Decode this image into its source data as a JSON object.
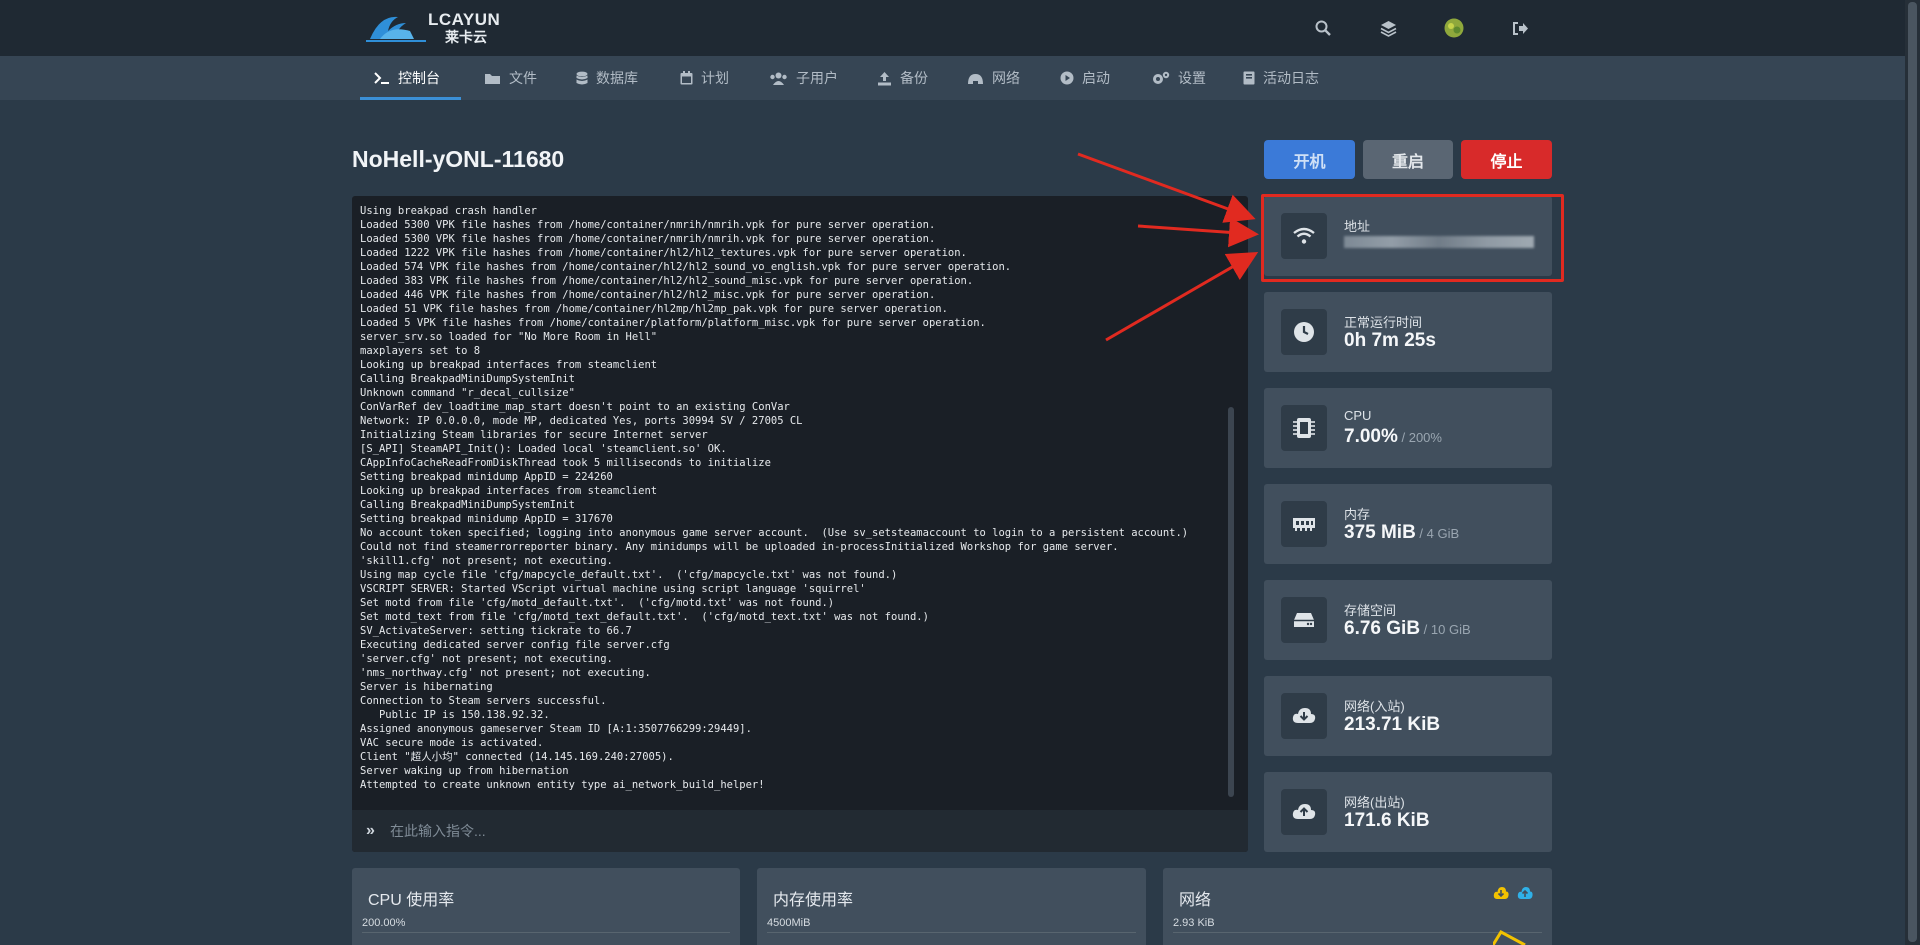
{
  "brand": {
    "logo_text": "LCAYUN",
    "logo_sub": "莱卡云"
  },
  "topbar": {
    "icons": [
      "search-icon",
      "layers-icon",
      "avatar",
      "logout-icon"
    ]
  },
  "nav": [
    {
      "label": "控制台",
      "icon": "terminal-icon",
      "active": true
    },
    {
      "label": "文件",
      "icon": "folder-icon"
    },
    {
      "label": "数据库",
      "icon": "database-icon"
    },
    {
      "label": "计划",
      "icon": "calendar-icon"
    },
    {
      "label": "子用户",
      "icon": "users-icon"
    },
    {
      "label": "备份",
      "icon": "upload-icon"
    },
    {
      "label": "网络",
      "icon": "network-icon"
    },
    {
      "label": "启动",
      "icon": "play-icon"
    },
    {
      "label": "设置",
      "icon": "gears-icon"
    },
    {
      "label": "活动日志",
      "icon": "book-icon"
    }
  ],
  "server": {
    "title": "NoHell-yONL-11680"
  },
  "power": {
    "start": "开机",
    "restart": "重启",
    "stop": "停止"
  },
  "console": {
    "lines": [
      "Using breakpad crash handler",
      "Loaded 5300 VPK file hashes from /home/container/nmrih/nmrih.vpk for pure server operation.",
      "Loaded 5300 VPK file hashes from /home/container/nmrih/nmrih.vpk for pure server operation.",
      "Loaded 1222 VPK file hashes from /home/container/hl2/hl2_textures.vpk for pure server operation.",
      "Loaded 574 VPK file hashes from /home/container/hl2/hl2_sound_vo_english.vpk for pure server operation.",
      "Loaded 383 VPK file hashes from /home/container/hl2/hl2_sound_misc.vpk for pure server operation.",
      "Loaded 446 VPK file hashes from /home/container/hl2/hl2_misc.vpk for pure server operation.",
      "Loaded 51 VPK file hashes from /home/container/hl2mp/hl2mp_pak.vpk for pure server operation.",
      "Loaded 5 VPK file hashes from /home/container/platform/platform_misc.vpk for pure server operation.",
      "server_srv.so loaded for \"No More Room in Hell\"",
      "maxplayers set to 8",
      "Looking up breakpad interfaces from steamclient",
      "Calling BreakpadMiniDumpSystemInit",
      "Unknown command \"r_decal_cullsize\"",
      "ConVarRef dev_loadtime_map_start doesn't point to an existing ConVar",
      "Network: IP 0.0.0.0, mode MP, dedicated Yes, ports 30994 SV / 27005 CL",
      "Initializing Steam libraries for secure Internet server",
      "[S_API] SteamAPI_Init(): Loaded local 'steamclient.so' OK.",
      "CAppInfoCacheReadFromDiskThread took 5 milliseconds to initialize",
      "Setting breakpad minidump AppID = 224260",
      "Looking up breakpad interfaces from steamclient",
      "Calling BreakpadMiniDumpSystemInit",
      "Setting breakpad minidump AppID = 317670",
      "No account token specified; logging into anonymous game server account.  (Use sv_setsteamaccount to login to a persistent account.)",
      "Could not find steamerrorreporter binary. Any minidumps will be uploaded in-processInitialized Workshop for game server.",
      "'skill1.cfg' not present; not executing.",
      "Using map cycle file 'cfg/mapcycle_default.txt'.  ('cfg/mapcycle.txt' was not found.)",
      "VSCRIPT SERVER: Started VScript virtual machine using script language 'squirrel'",
      "Set motd from file 'cfg/motd_default.txt'.  ('cfg/motd.txt' was not found.)",
      "Set motd_text from file 'cfg/motd_text_default.txt'.  ('cfg/motd_text.txt' was not found.)",
      "SV_ActivateServer: setting tickrate to 66.7",
      "Executing dedicated server config file server.cfg",
      "'server.cfg' not present; not executing.",
      "'nms_northway.cfg' not present; not executing.",
      "Server is hibernating",
      "Connection to Steam servers successful.",
      "   Public IP is 150.138.92.32.",
      "Assigned anonymous gameserver Steam ID [A:1:3507766299:29449].",
      "VAC secure mode is activated.",
      "Client \"超人小均\" connected (14.145.169.240:27005).",
      "Server waking up from hibernation",
      "Attempted to create unknown entity type ai_network_build_helper!"
    ],
    "prompt": "»",
    "placeholder": "在此输入指令..."
  },
  "stats": [
    {
      "label": "地址",
      "value": "",
      "icon": "wifi-icon"
    },
    {
      "label": "正常运行时间",
      "value": "0h 7m 25s",
      "sub": "",
      "icon": "clock-icon"
    },
    {
      "label": "CPU",
      "value": "7.00%",
      "sub": " / 200%",
      "icon": "chip-icon"
    },
    {
      "label": "内存",
      "value": "375 MiB",
      "sub": " / 4 GiB",
      "icon": "memory-icon"
    },
    {
      "label": "存储空间",
      "value": "6.76 GiB",
      "sub": " / 10 GiB",
      "icon": "hdd-icon"
    },
    {
      "label": "网络(入站)",
      "value": "213.71 KiB",
      "sub": "",
      "icon": "cloud-download-icon"
    },
    {
      "label": "网络(出站)",
      "value": "171.6 KiB",
      "sub": "",
      "icon": "cloud-upload-icon"
    }
  ],
  "graphs": [
    {
      "title": "CPU 使用率",
      "ymax": "200.00%"
    },
    {
      "title": "内存使用率",
      "ymax": "4500MiB"
    },
    {
      "title": "网络",
      "ymax": "2.93 KiB"
    }
  ],
  "colors": {
    "accent": "#3b8fd6",
    "start": "#3b7ad8",
    "restart": "#5a6673",
    "stop": "#d82a2a",
    "highlight": "#e12a20",
    "net_in": "#f2c200",
    "net_out": "#2fb1e8"
  }
}
